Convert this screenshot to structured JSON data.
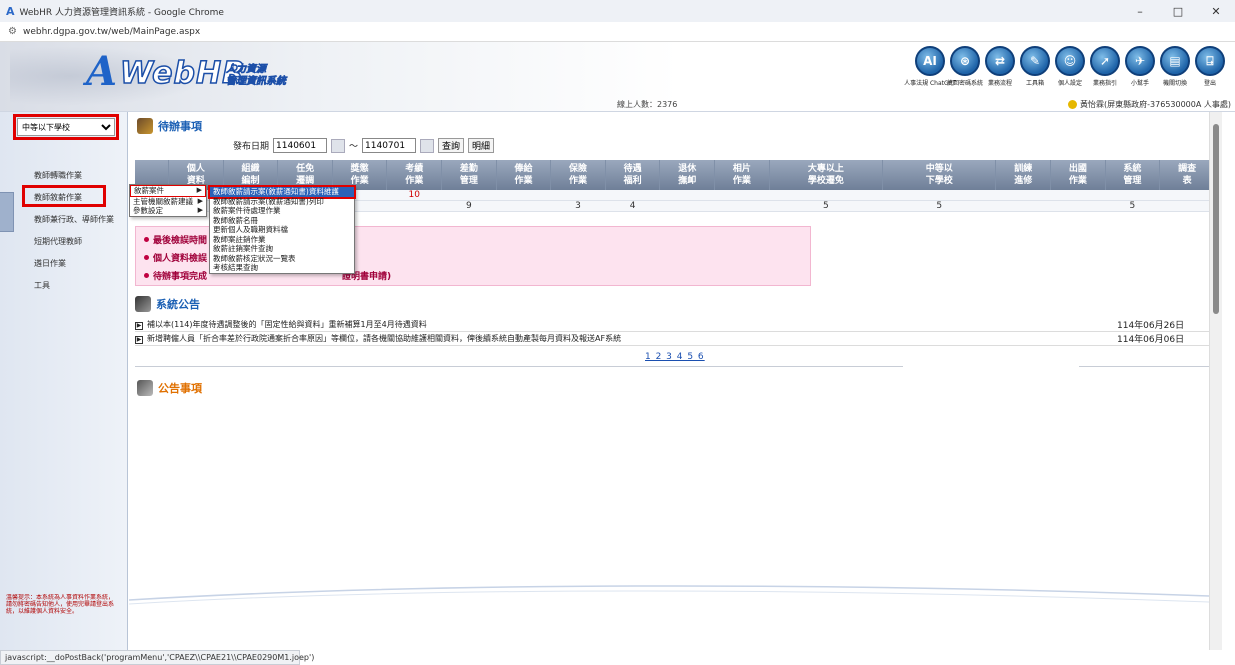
{
  "window": {
    "title": "WebHR 人力資源管理資訊系統 - Google Chrome",
    "url": "webhr.dgpa.gov.tw/web/MainPage.aspx",
    "controls": [
      "–",
      "□",
      "✕"
    ]
  },
  "header": {
    "logo_text": "WebHR",
    "logo_sub_1": "人力資源",
    "logo_sub_2": "管理資訊系統",
    "online_count": "線上人數：2376",
    "user_info": "黃怡霖(屏東縣政府-376530000A 人事處)",
    "toolbar": [
      {
        "label": "人事法規 ChatGPT",
        "icon": "chatgpt-icon",
        "glyph": "AI"
      },
      {
        "label": "找回密碼系統",
        "icon": "lifebuoy-icon",
        "glyph": "⊛"
      },
      {
        "label": "業務流程",
        "icon": "flow-icon",
        "glyph": "⇄"
      },
      {
        "label": "工具箱",
        "icon": "toolbox-icon",
        "glyph": "✎"
      },
      {
        "label": "個人設定",
        "icon": "person-settings-icon",
        "glyph": "☺"
      },
      {
        "label": "業務指引",
        "icon": "guide-icon",
        "glyph": "➚"
      },
      {
        "label": "小幫手",
        "icon": "helper-icon",
        "glyph": "✈"
      },
      {
        "label": "機關切換",
        "icon": "switch-icon",
        "glyph": "▤"
      },
      {
        "label": "登出",
        "icon": "logout-icon",
        "glyph": "⍈"
      }
    ]
  },
  "sidebar": {
    "school_select": "中等以下學校",
    "items": [
      {
        "label": "教師轉職作業"
      },
      {
        "label": "教師敘薪作業"
      },
      {
        "label": "教師兼行政、導師作業"
      },
      {
        "label": "短期代理教師"
      },
      {
        "label": "遴日作業"
      },
      {
        "label": "工具"
      }
    ],
    "footer_note": "溫馨提示：本系統為人事資料作業系統，請勿將密碼告知他人，使用完畢請登出系統，以維護個人資料安全。"
  },
  "todo": {
    "title": "待辦事項",
    "date_label": "發布日期",
    "date_from": "1140601",
    "date_sep": "～",
    "date_to": "1140701",
    "query_button": "查詢",
    "help_button": "明細",
    "columns": [
      "個人\n資料",
      "組織\n編制",
      "任免\n遷調",
      "獎懲\n作業",
      "考績\n作業",
      "差勤\n管理",
      "俸給\n作業",
      "保險\n作業",
      "待遇\n福利",
      "退休\n撫卹",
      "相片\n作業",
      "大專以上\n學校遷免",
      "中等以\n下學校",
      "訓練\n進修",
      "出國\n作業",
      "系統\n管理",
      "調查\n表"
    ],
    "row1": [
      "",
      "",
      "",
      "",
      "10",
      "",
      "",
      "",
      "",
      "",
      "",
      "",
      "",
      "",
      "",
      "",
      ""
    ],
    "row2": [
      "",
      "",
      "",
      "",
      "",
      "9",
      "",
      "3",
      "4",
      "",
      "",
      "5",
      "5",
      "",
      "",
      "5",
      ""
    ],
    "notes": [
      {
        "label": "最後檢誤時間",
        "text": ""
      },
      {
        "label": "個人資料檢誤",
        "text": ""
      },
      {
        "label": "待辦事項完成",
        "text": "證明書申請)"
      }
    ]
  },
  "menu": {
    "level1": [
      {
        "label": "敘薪案件"
      },
      {
        "label": "主管機關敘薪建議"
      },
      {
        "label": "參數設定"
      }
    ],
    "level2": [
      {
        "label": "教師敘薪請示案(敘薪通知書)資料維護",
        "highlighted": true
      },
      {
        "label": "教師敘薪請示案(敘薪通知書)列印",
        "highlighted": false
      },
      {
        "label": "敘薪案件待處理作業",
        "highlighted": false
      },
      {
        "label": "教師敘薪名冊",
        "highlighted": false
      },
      {
        "label": "更新個人及職期資料檔",
        "highlighted": false
      },
      {
        "label": "教師案註銷作業",
        "highlighted": false
      },
      {
        "label": "敘薪註銷案件查詢",
        "highlighted": false
      },
      {
        "label": "教師敘薪核定狀況一覽表",
        "highlighted": false
      },
      {
        "label": "考核結果查詢",
        "highlighted": false
      }
    ]
  },
  "system_announcements": {
    "title": "系統公告",
    "items": [
      {
        "text": "補以本(114)年度待遇調整後的「固定性給與資料」重新補算1月至4月待遇資料",
        "date": "114年06月26日"
      },
      {
        "text": "新增聘僱人員「折合率差於行政院通案折合率原因」等欄位，請各機關協助維護相關資料，俾後續系統自動產製每月資料及報送AF系統",
        "date": "114年06月06日"
      }
    ],
    "pages": "1 2 3 4 5 6"
  },
  "announcements": {
    "title": "公告事項"
  },
  "status_bar": "javascript:__doPostBack('programMenu','CPAEZ\\\\CPAE21\\\\CPAE0290M1.joep')"
}
